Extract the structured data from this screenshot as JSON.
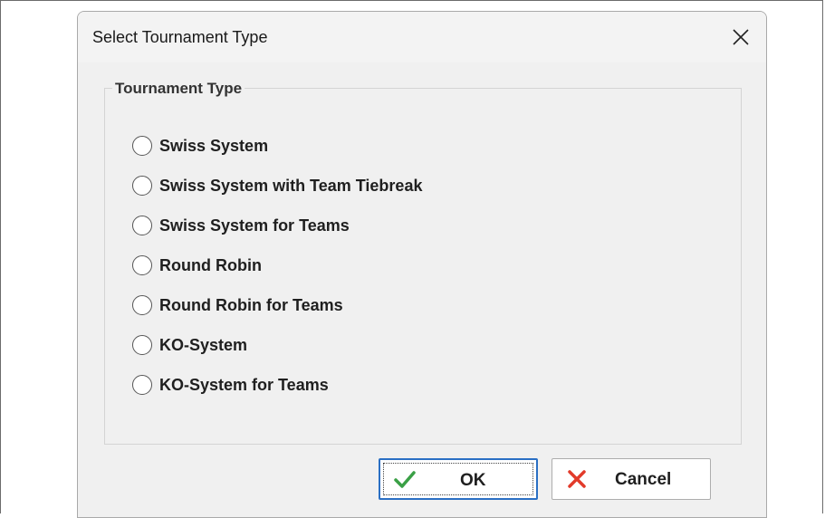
{
  "dialog": {
    "title": "Select Tournament Type",
    "close_icon": "close-icon"
  },
  "group": {
    "legend": "Tournament Type",
    "options": [
      {
        "label": "Swiss System",
        "selected": false
      },
      {
        "label": "Swiss System with Team Tiebreak",
        "selected": false
      },
      {
        "label": "Swiss System for Teams",
        "selected": false
      },
      {
        "label": "Round Robin",
        "selected": false
      },
      {
        "label": "Round Robin for Teams",
        "selected": false
      },
      {
        "label": "KO-System",
        "selected": false
      },
      {
        "label": "KO-System for Teams",
        "selected": false
      }
    ]
  },
  "buttons": {
    "ok_label": "OK",
    "ok_icon": "checkmark-icon",
    "cancel_label": "Cancel",
    "cancel_icon": "x-icon"
  },
  "colors": {
    "ok_check": "#3aa046",
    "cancel_x": "#e23b2b",
    "focus_border": "#2a6fc4"
  }
}
